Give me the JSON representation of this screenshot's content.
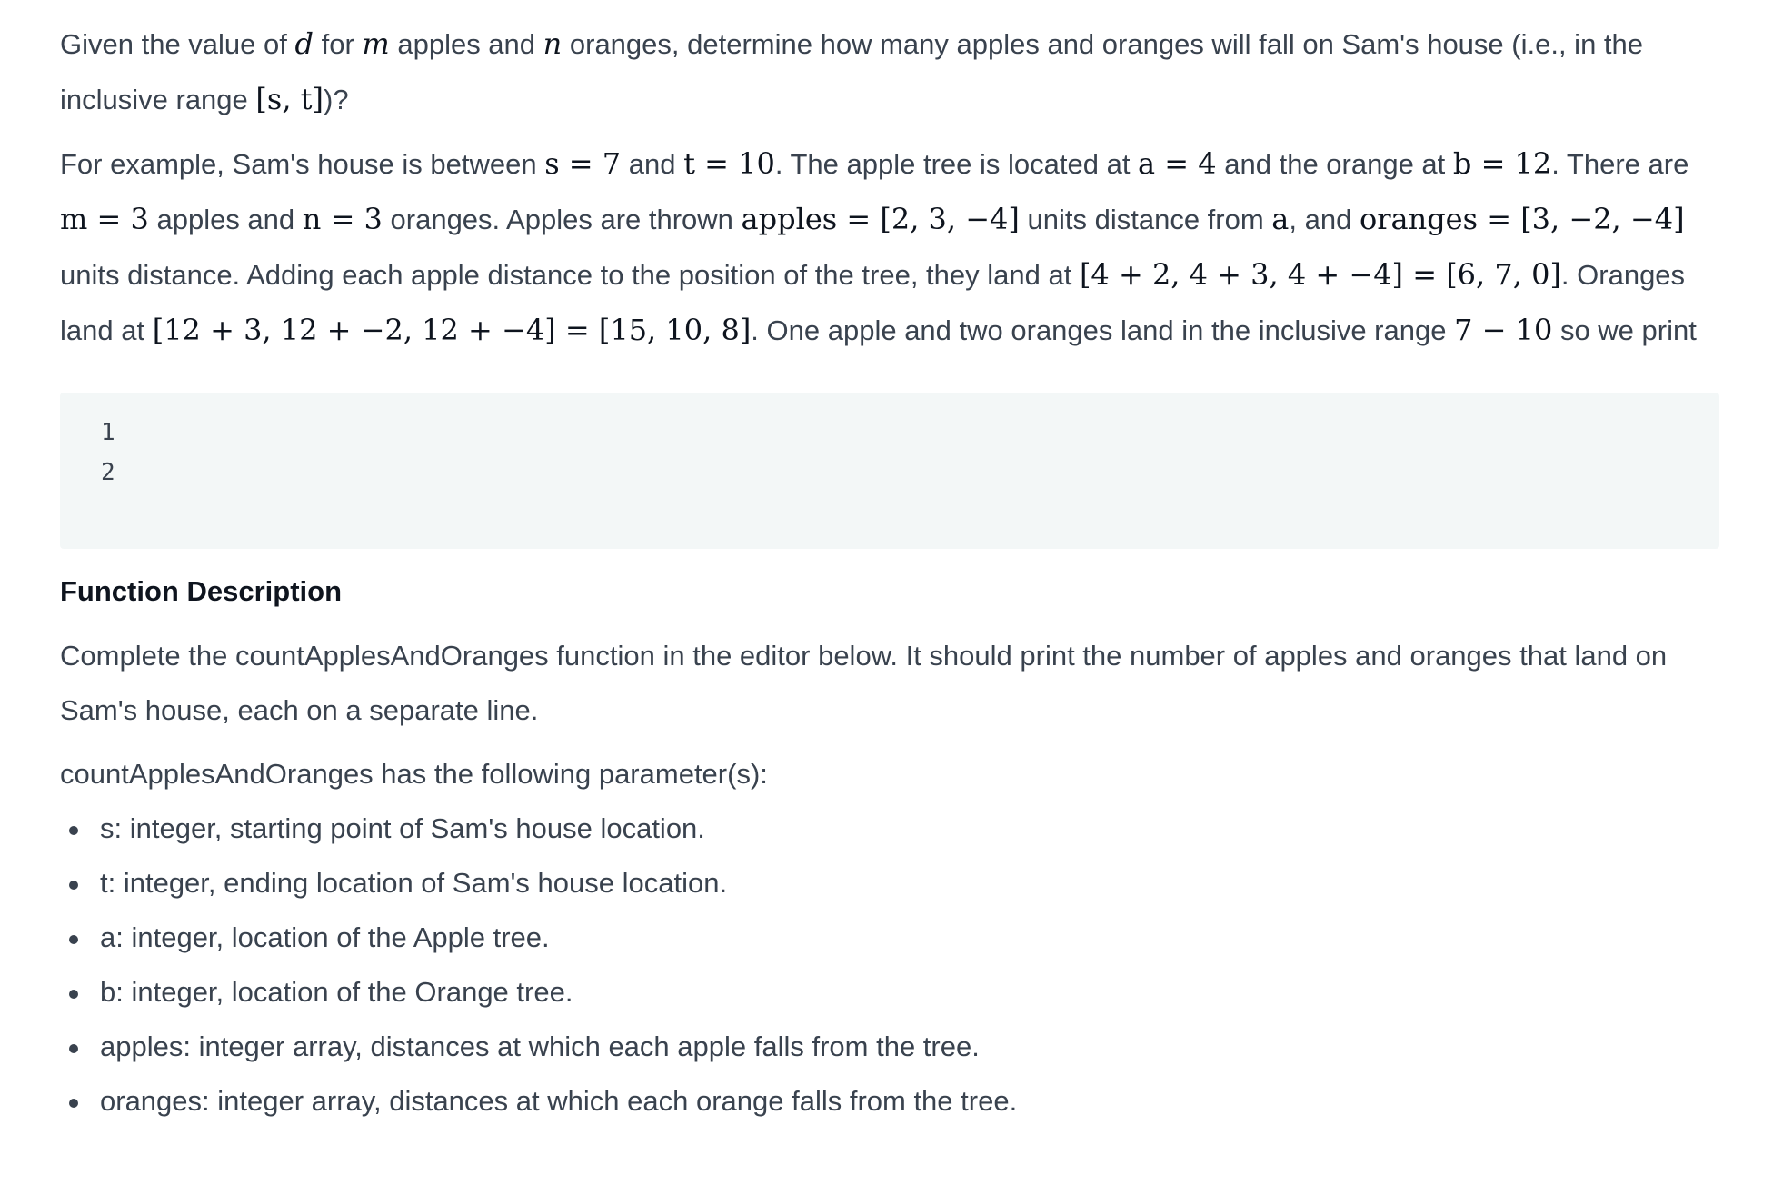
{
  "intro": {
    "t1": "Given the value of ",
    "v_d": "d",
    "t2": " for ",
    "v_m": "m",
    "t3": " apples and ",
    "v_n": "n",
    "t4": " oranges, determine how many apples and oranges will fall on Sam's house (i.e., in the inclusive range ",
    "range_math": "[s, t]",
    "t5": ")?"
  },
  "example": {
    "t1": "For example, Sam's house is between ",
    "m1": "s = 7",
    "t2": " and ",
    "m2": "t = 10",
    "t3": ". The apple tree is located at ",
    "m3": "a = 4",
    "t4": " and the orange at ",
    "m4": "b = 12",
    "t5": ". There are ",
    "m5": "m = 3",
    "t6": " apples and ",
    "m6": "n = 3",
    "t7": " oranges. Apples are thrown ",
    "m7": "apples = [2, 3, −4]",
    "t8": " units distance from ",
    "m8": "a",
    "t9": ", and ",
    "m9": "oranges = [3, −2, −4]",
    "t10": " units distance. Adding each apple distance to the position of the tree, they land at ",
    "m10": "[4 + 2, 4 + 3, 4 + −4] = [6, 7, 0]",
    "t11": ". Oranges land at ",
    "m11": "[12 + 3, 12 + −2, 12 + −4] = [15, 10, 8]",
    "t12": ". One apple and two oranges land in the inclusive range ",
    "m12": "7 − 10",
    "t13": " so we print"
  },
  "sample_output": {
    "lines": [
      "1",
      "2"
    ]
  },
  "function_description": {
    "heading": "Function Description",
    "paragraph": "Complete the countApplesAndOranges function in the editor below. It should print the number of apples and oranges that land on Sam's house, each on a separate line.",
    "params_intro": "countApplesAndOranges has the following parameter(s):",
    "params": [
      "s: integer, starting point of Sam's house location.",
      "t: integer, ending location of Sam's house location.",
      "a: integer, location of the Apple tree.",
      "b: integer, location of the Orange tree.",
      "apples: integer array, distances at which each apple falls from the tree.",
      "oranges: integer array, distances at which each orange falls from the tree."
    ]
  },
  "colors": {
    "text": "#39424e",
    "math": "#0e141e",
    "code_background": "#f3f7f7"
  }
}
